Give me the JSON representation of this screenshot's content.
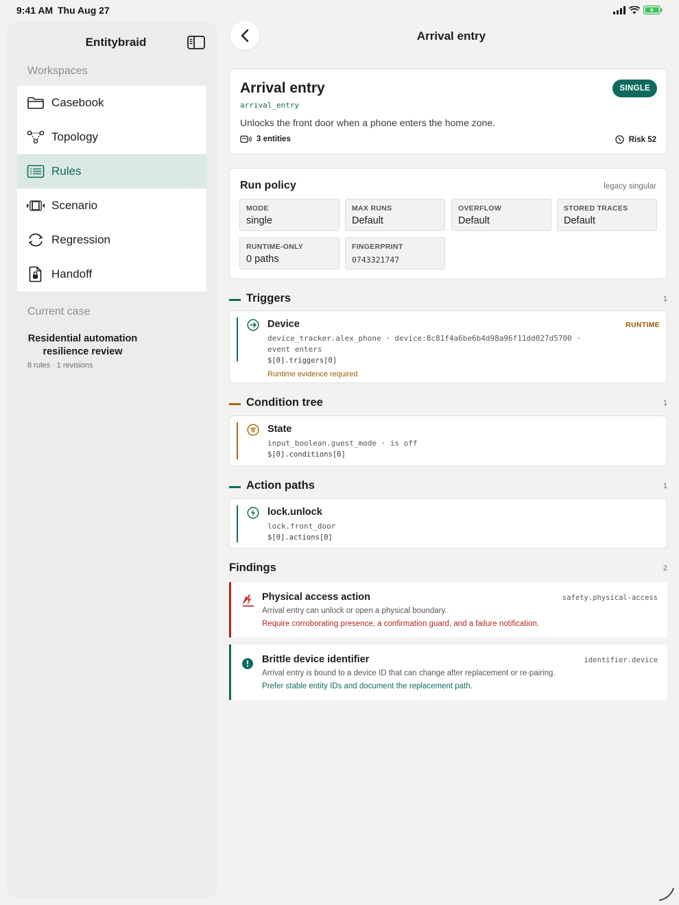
{
  "status_bar": {
    "time": "9:41 AM",
    "date": "Thu Aug 27"
  },
  "sidebar": {
    "app_title": "Entitybraid",
    "workspaces_label": "Workspaces",
    "items": [
      {
        "label": "Casebook",
        "icon": "folder-icon",
        "active": false
      },
      {
        "label": "Topology",
        "icon": "topology-icon",
        "active": false
      },
      {
        "label": "Rules",
        "icon": "list-icon",
        "active": true
      },
      {
        "label": "Scenario",
        "icon": "film-icon",
        "active": false
      },
      {
        "label": "Regression",
        "icon": "cycle-icon",
        "active": false
      },
      {
        "label": "Handoff",
        "icon": "locked-document-icon",
        "active": false
      }
    ],
    "current_case_label": "Current case",
    "case_title": "Residential automation resilience review",
    "case_meta": "8 rules · 1 revisions"
  },
  "header": {
    "title": "Arrival entry"
  },
  "rule": {
    "title": "Arrival entry",
    "slug": "arrival_entry",
    "description": "Unlocks the front door when a phone enters the home zone.",
    "entities": "3 entities",
    "risk": "Risk 52",
    "badge": "SINGLE"
  },
  "run_policy": {
    "title": "Run policy",
    "note": "legacy singular",
    "cells": [
      {
        "key": "MODE",
        "value": "single"
      },
      {
        "key": "MAX RUNS",
        "value": "Default"
      },
      {
        "key": "OVERFLOW",
        "value": "Default"
      },
      {
        "key": "STORED TRACES",
        "value": "Default"
      },
      {
        "key": "RUNTIME-ONLY",
        "value": "0 paths"
      },
      {
        "key": "FINGERPRINT",
        "value": "0743321747"
      }
    ]
  },
  "triggers": {
    "title": "Triggers",
    "count": "1",
    "color": "#0e6b5c",
    "item": {
      "name": "Device",
      "tag": "RUNTIME",
      "line1": "device_tracker.alex_phone  ·  device:8c81f4a6be6b4d98a96f11dd027d5700  ·",
      "line2": "event enters",
      "path": "$[0].triggers[0]",
      "evidence": "Runtime evidence required"
    }
  },
  "conditions": {
    "title": "Condition tree",
    "count": "1",
    "color": "#a86a12",
    "item": {
      "name": "State",
      "line1": "input_boolean.guest_mode  ·  is off",
      "path": "$[0].conditions[0]"
    }
  },
  "actions": {
    "title": "Action paths",
    "count": "1",
    "color": "#0e6b5c",
    "item": {
      "name": "lock.unlock",
      "line1": "lock.front_door",
      "path": "$[0].actions[0]"
    }
  },
  "findings": {
    "title": "Findings",
    "count": "2",
    "items": [
      {
        "title": "Physical access action",
        "code": "safety.physical-access",
        "description": "Arrival entry can unlock or open a physical boundary.",
        "fix": "Require corroborating presence, a confirmation guard, and a failure notification.",
        "color": "#b3261e"
      },
      {
        "title": "Brittle device identifier",
        "code": "identifier.device",
        "description": "Arrival entry is bound to a device ID that can change after replacement or re-pairing.",
        "fix": "Prefer stable entity IDs and document the replacement path.",
        "color": "#0e6b5c"
      }
    ]
  }
}
